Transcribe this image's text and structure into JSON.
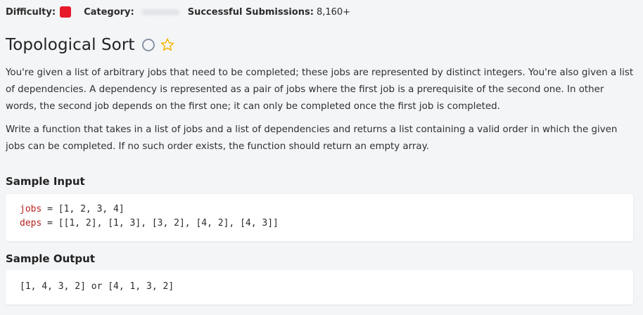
{
  "meta": {
    "difficulty_label": "Difficulty:",
    "difficulty_color": "#e8182b",
    "category_label": "Category:",
    "submissions_label": "Successful Submissions:",
    "submissions_value": "8,160+"
  },
  "problem": {
    "title": "Topological Sort",
    "status_icon": "circle-icon",
    "favorite_icon": "star-icon",
    "paragraphs": [
      "You're given a list of arbitrary jobs that need to be completed; these jobs are represented by distinct integers. You're also given a list of dependencies. A dependency is represented as a pair of jobs where the first job is a prerequisite of the second one. In other words, the second job depends on the first one; it can only be completed once the first job is completed.",
      "Write a function that takes in a list of jobs and a list of dependencies and returns a list containing a valid order in which the given jobs can be completed. If no such order exists, the function should return an empty array."
    ]
  },
  "sample_input": {
    "heading": "Sample Input",
    "lines": [
      {
        "var": "jobs",
        "rest": " = [1, 2, 3, 4]"
      },
      {
        "var": "deps",
        "rest": " = [[1, 2], [1, 3], [3, 2], [4, 2], [4, 3]]"
      }
    ]
  },
  "sample_output": {
    "heading": "Sample Output",
    "line": "[1, 4, 3, 2] or [4, 1, 3, 2]"
  }
}
